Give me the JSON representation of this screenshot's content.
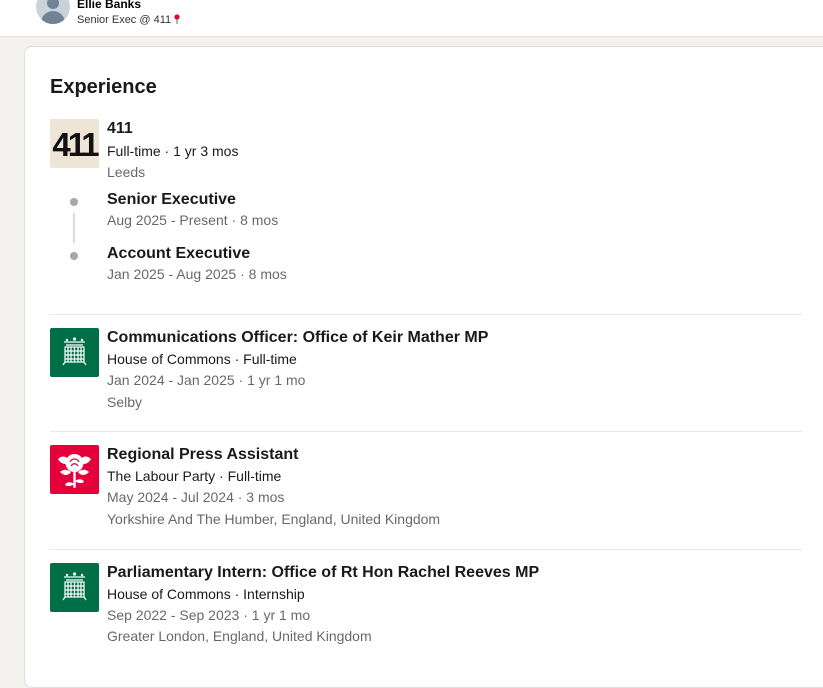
{
  "header": {
    "name": "Ellie Banks",
    "headline": "Senior Exec @ 411"
  },
  "experience": {
    "title": "Experience",
    "company_411": {
      "logo_text": "411",
      "name": "411",
      "type_duration": "Full-time · 1 yr 3 mos",
      "location": "Leeds",
      "roles": [
        {
          "title": "Senior Executive",
          "dates": "Aug 2025 - Present · 8 mos"
        },
        {
          "title": "Account Executive",
          "dates": "Jan 2025 - Aug 2025 · 8 mos"
        }
      ]
    },
    "items": [
      {
        "title": "Communications Officer: Office of Keir Mather MP",
        "company": "House of Commons · Full-time",
        "dates": "Jan 2024 - Jan 2025 · 1 yr 1 mo",
        "location": "Selby",
        "logo": "portcullis-icon"
      },
      {
        "title": "Regional Press Assistant",
        "company": "The Labour Party · Full-time",
        "dates": "May 2024 - Jul 2024 · 3 mos",
        "location": "Yorkshire And The Humber, England, United Kingdom",
        "logo": "rose-icon"
      },
      {
        "title": "Parliamentary Intern: Office of Rt Hon Rachel Reeves MP",
        "company": "House of Commons · Internship",
        "dates": "Sep 2022 - Sep 2023 · 1 yr 1 mo",
        "location": "Greater London, England, United Kingdom",
        "logo": "portcullis-icon"
      }
    ]
  },
  "colors": {
    "hoc_green": "#006e46",
    "labour_red": "#e4003b",
    "logo_411_bg": "#efe5d7"
  }
}
